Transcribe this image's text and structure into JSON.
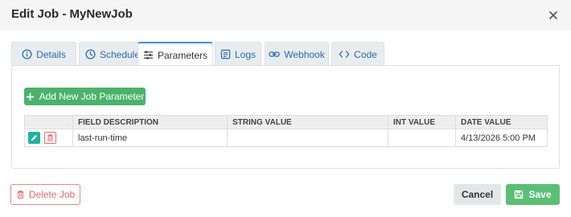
{
  "modal": {
    "title": "Edit Job - MyNewJob"
  },
  "tabs": [
    {
      "label": "Details",
      "icon": "info-icon"
    },
    {
      "label": "Schedule",
      "icon": "clock-icon"
    },
    {
      "label": "Parameters",
      "icon": "sliders-icon",
      "active": true
    },
    {
      "label": "Logs",
      "icon": "list-icon"
    },
    {
      "label": "Webhook",
      "icon": "link-icon"
    },
    {
      "label": "Code",
      "icon": "code-icon"
    }
  ],
  "parameters": {
    "add_button_label": "Add New Job Parameter",
    "columns": [
      "FIELD DESCRIPTION",
      "STRING VALUE",
      "INT VALUE",
      "DATE VALUE"
    ],
    "rows": [
      {
        "field_description": "last-run-time",
        "string_value": "",
        "int_value": "",
        "date_value": "4/13/2026 5:00 PM"
      }
    ]
  },
  "footer": {
    "delete_label": "Delete Job",
    "cancel_label": "Cancel",
    "save_label": "Save"
  },
  "colors": {
    "accent_green": "#4bb26a",
    "save_green": "#5cbf76",
    "danger_red": "#e06b6b",
    "tab_link_blue": "#2a6cb3",
    "active_tab_border": "#3a8ee6",
    "edit_teal": "#22b2a0"
  }
}
